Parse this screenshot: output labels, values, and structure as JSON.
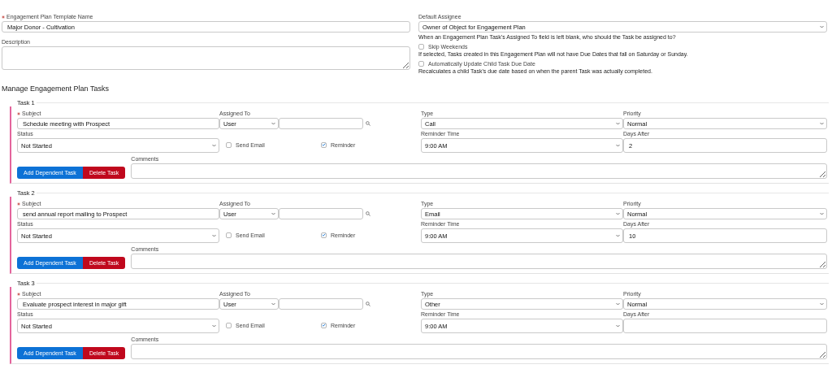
{
  "template_name": {
    "label": "Engagement Plan Template Name",
    "required": true,
    "value": "Major Donor - Cultivation"
  },
  "description": {
    "label": "Description"
  },
  "default_assignee": {
    "label": "Default Assignee",
    "value": "Owner of Object for Engagement Plan",
    "help": "When an Engagement Plan Task's Assigned To field is left blank, who should the Task be assigned to?"
  },
  "options": [
    {
      "label": "Skip Weekends",
      "checked": false,
      "help": "If selected, Tasks created in this Engagement Plan will not have Due Dates that fall on Saturday or Sunday."
    },
    {
      "label": "Automatically Update Child Task Due Date",
      "checked": false,
      "help": "Recalculates a child Task's due date based on when the parent Task was actually completed."
    }
  ],
  "section_title": "Manage Engagement Plan Tasks",
  "tasks": [
    {
      "title": "Task 1",
      "subject": {
        "label": "Subject",
        "required": true,
        "value": "Schedule meeting with Prospect"
      },
      "assigned_to": {
        "label": "Assigned To",
        "value": "User"
      },
      "type": {
        "label": "Type",
        "value": "Call"
      },
      "priority": {
        "label": "Priority",
        "value": "Normal"
      },
      "status": {
        "label": "Status",
        "value": "Not Started"
      },
      "send_email": {
        "label": "Send Email",
        "checked": false
      },
      "reminder": {
        "label": "Reminder",
        "checked": true
      },
      "reminder_time": {
        "label": "Reminder Time",
        "value": "9:00 AM"
      },
      "days_after": {
        "label": "Days After",
        "value": "2"
      },
      "comments": {
        "label": "Comments"
      },
      "buttons": [
        {
          "label": "Add Dependent Task",
          "kind": "primary"
        },
        {
          "label": "Delete Task",
          "kind": "danger"
        }
      ]
    },
    {
      "title": "Task 2",
      "subject": {
        "label": "Subject",
        "required": true,
        "value": "send annual report mailing to Prospect"
      },
      "assigned_to": {
        "label": "Assigned To",
        "value": "User"
      },
      "type": {
        "label": "Type",
        "value": "Email"
      },
      "priority": {
        "label": "Priority",
        "value": "Normal"
      },
      "status": {
        "label": "Status",
        "value": "Not Started"
      },
      "send_email": {
        "label": "Send Email",
        "checked": false
      },
      "reminder": {
        "label": "Reminder",
        "checked": true
      },
      "reminder_time": {
        "label": "Reminder Time",
        "value": "9:00 AM"
      },
      "days_after": {
        "label": "Days After",
        "value": "10"
      },
      "comments": {
        "label": "Comments"
      },
      "buttons": [
        {
          "label": "Add Dependent Task",
          "kind": "primary"
        },
        {
          "label": "Delete Task",
          "kind": "danger"
        }
      ]
    },
    {
      "title": "Task 3",
      "subject": {
        "label": "Subject",
        "required": true,
        "value": "Evaluate prospect interest in major gift"
      },
      "assigned_to": {
        "label": "Assigned To",
        "value": "User"
      },
      "type": {
        "label": "Type",
        "value": "Other"
      },
      "priority": {
        "label": "Priority",
        "value": "Normal"
      },
      "status": {
        "label": "Status",
        "value": "Not Started"
      },
      "send_email": {
        "label": "Send Email",
        "checked": false
      },
      "reminder": {
        "label": "Reminder",
        "checked": true
      },
      "reminder_time": {
        "label": "Reminder Time",
        "value": "9:00 AM"
      },
      "days_after": {
        "label": "Days After"
      },
      "comments": {
        "label": "Comments"
      },
      "buttons": [
        {
          "label": "Add Dependent Task",
          "kind": "primary"
        },
        {
          "label": "Delete Task",
          "kind": "danger"
        }
      ]
    }
  ]
}
